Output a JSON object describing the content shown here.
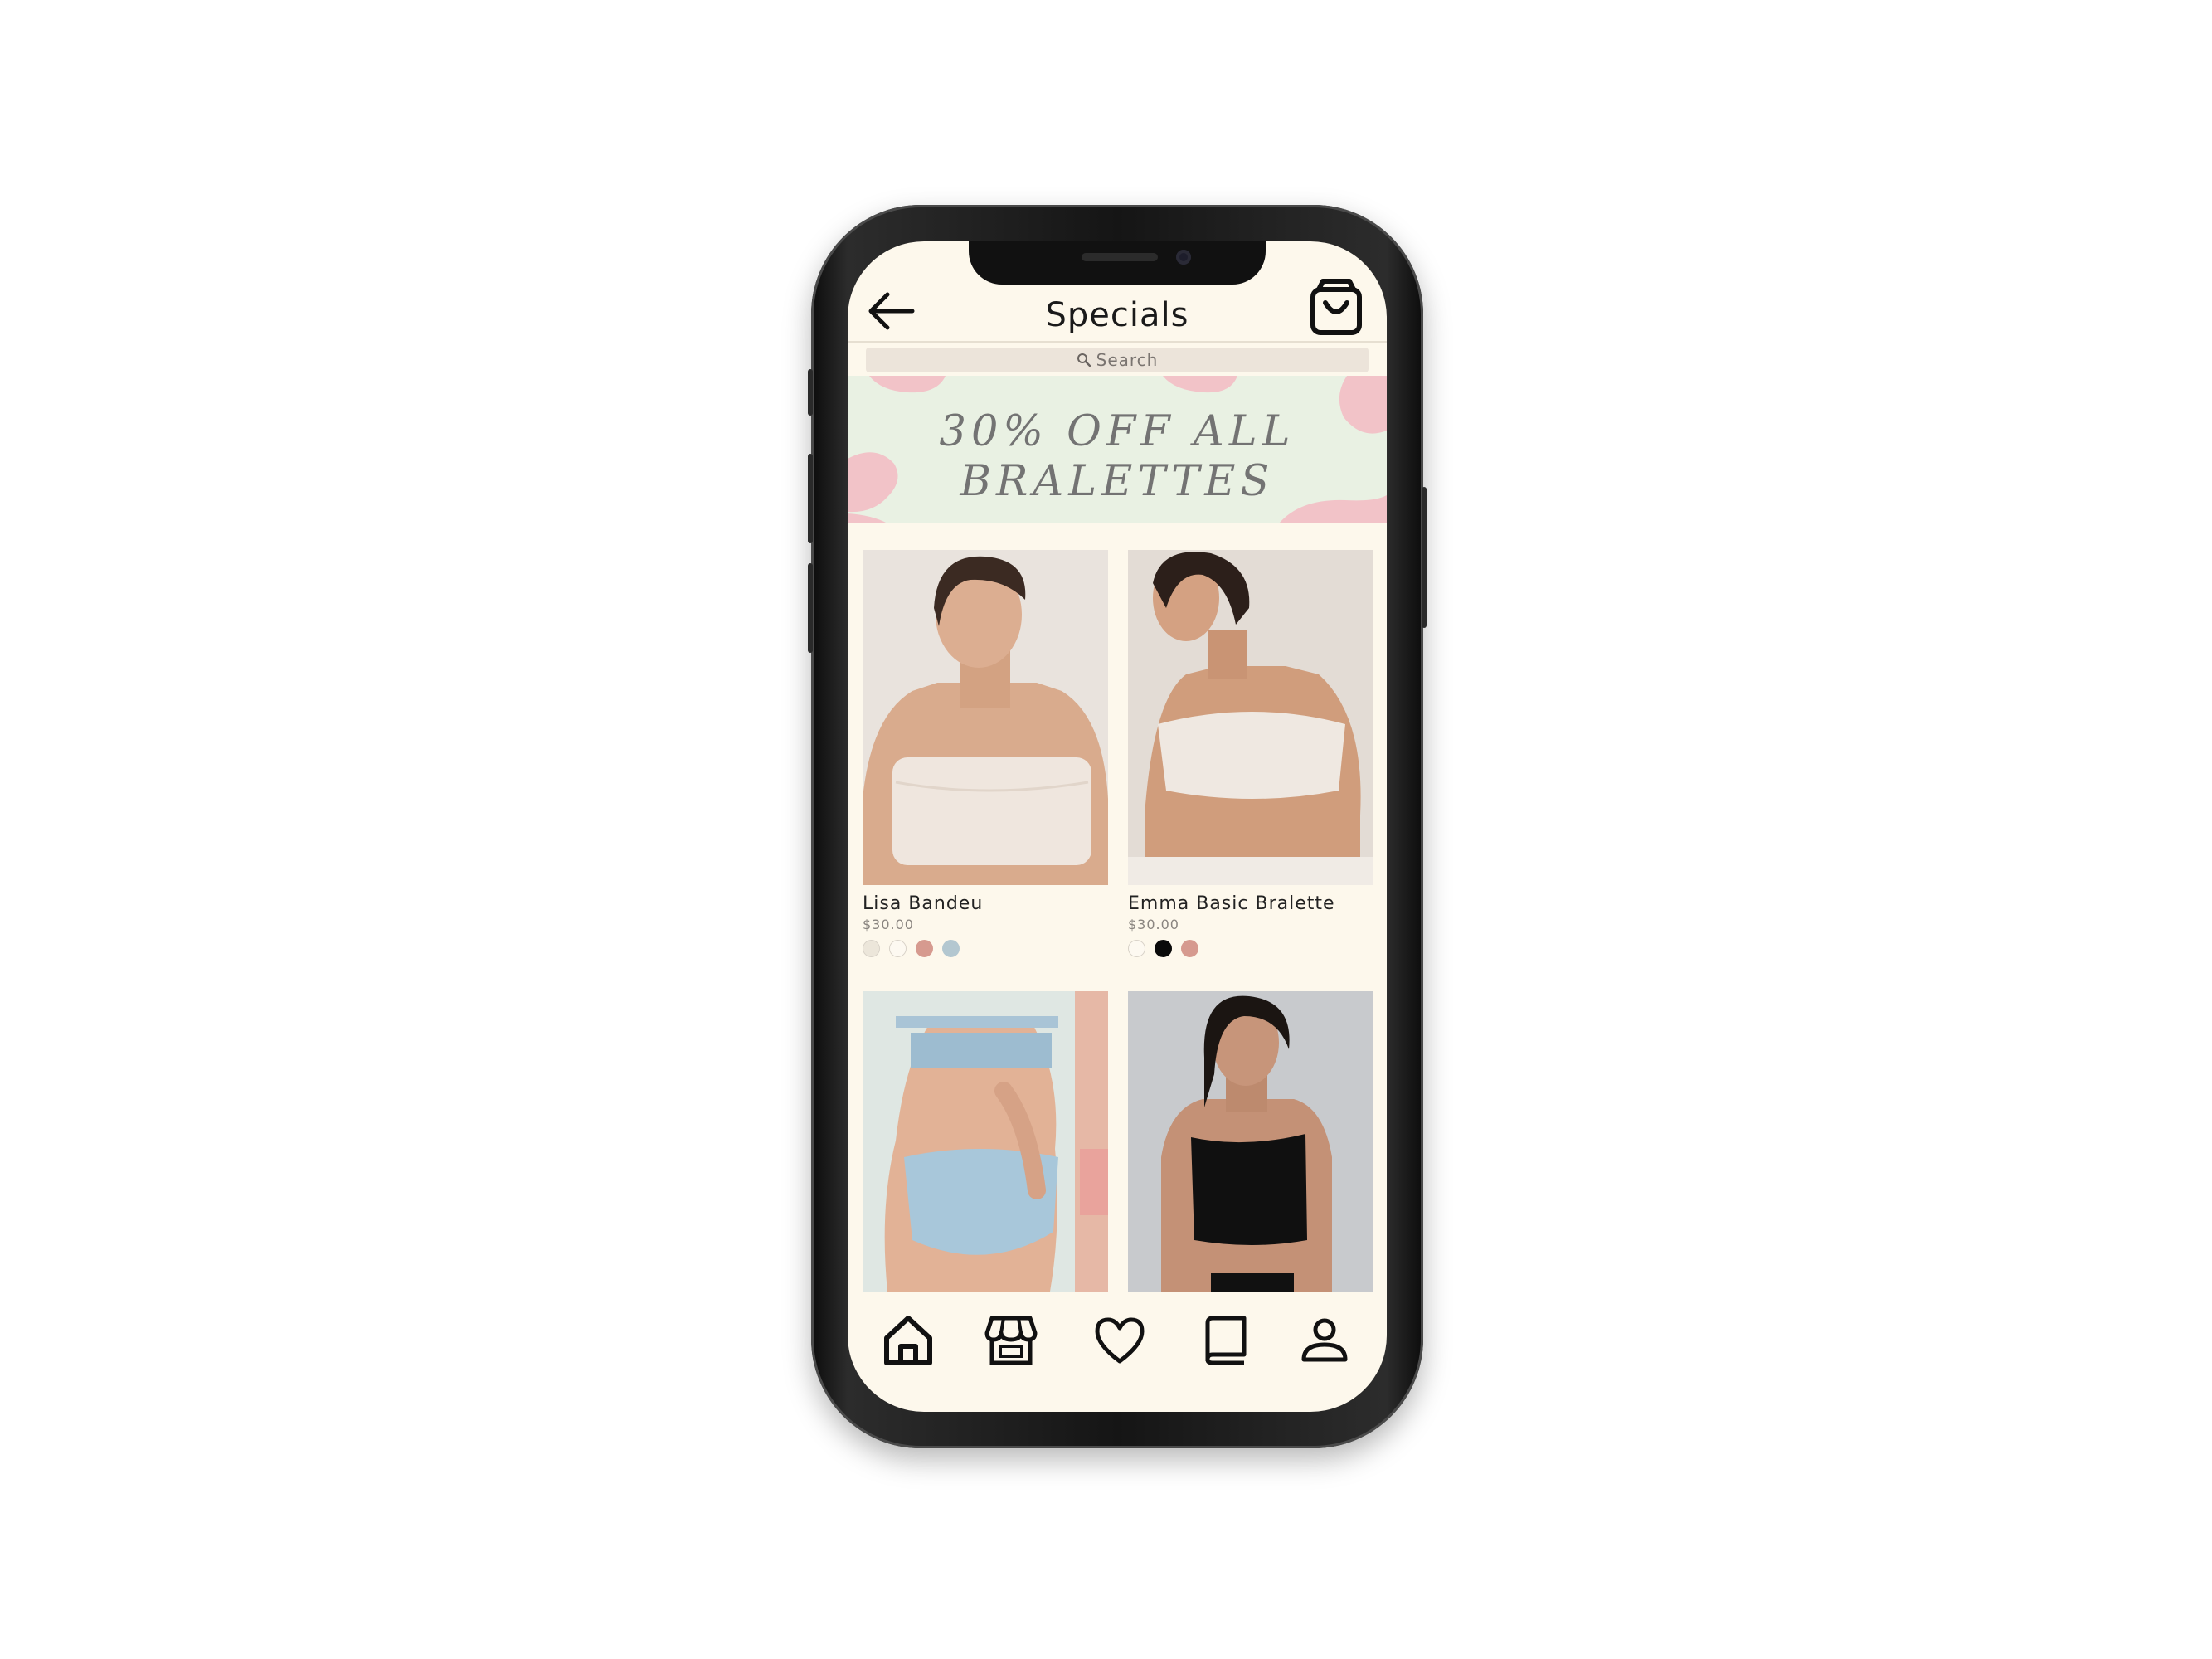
{
  "header": {
    "title": "Specials"
  },
  "search": {
    "placeholder": "Search"
  },
  "banner": {
    "line1": "30% OFF ALL",
    "line2": "BRALETTES"
  },
  "products": [
    {
      "name": "Lisa Bandeu",
      "price": "$30.00",
      "swatches": [
        "#ece6da",
        "#fdf9f1",
        "#d69a8f",
        "#b3c7d0"
      ]
    },
    {
      "name": "Emma Basic Bralette",
      "price": "$30.00",
      "swatches": [
        "#fdf9f1",
        "#0a0a0a",
        "#d69a8f"
      ]
    },
    {
      "name": "",
      "price": "",
      "swatches": []
    },
    {
      "name": "",
      "price": "",
      "swatches": []
    }
  ],
  "colors": {
    "background": "#fdf8ec",
    "banner_green": "#e9f1e3",
    "banner_pink": "#f2c3c8",
    "search_bg": "#ece4da"
  },
  "nav": {
    "icons": [
      "home-icon",
      "store-icon",
      "heart-icon",
      "book-icon",
      "profile-icon"
    ]
  }
}
